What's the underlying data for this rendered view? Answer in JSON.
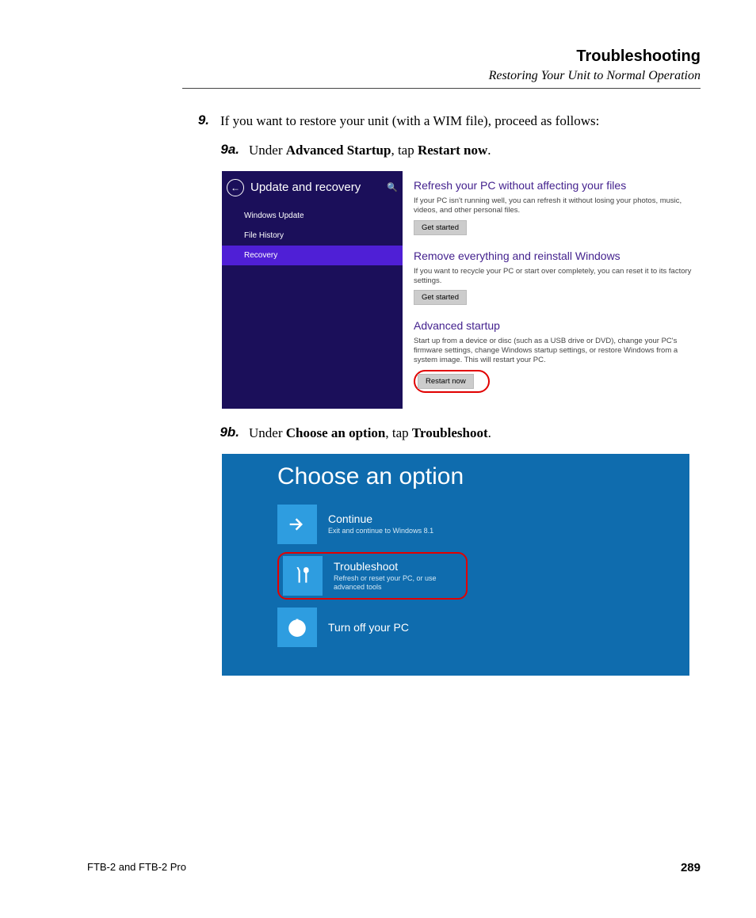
{
  "header": {
    "title": "Troubleshooting",
    "subtitle": "Restoring Your Unit to Normal Operation"
  },
  "step9": {
    "num": "9.",
    "text_plain": "If you want to restore your unit (with a WIM file), proceed as follows:"
  },
  "step9a": {
    "num": "9a.",
    "prefix": "Under ",
    "bold1": "Advanced Startup",
    "mid": ", tap ",
    "bold2": "Restart now",
    "suffix": "."
  },
  "step9b": {
    "num": "9b.",
    "prefix": "Under ",
    "bold1": "Choose an option",
    "mid": ", tap ",
    "bold2": "Troubleshoot",
    "suffix": "."
  },
  "shot1": {
    "panel_title": "Update and recovery",
    "nav": {
      "item1": "Windows Update",
      "item2": "File History",
      "item3": "Recovery"
    },
    "refresh": {
      "heading": "Refresh your PC without affecting your files",
      "desc": "If your PC isn't running well, you can refresh it without losing your photos, music, videos, and other personal files.",
      "button": "Get started"
    },
    "remove": {
      "heading": "Remove everything and reinstall Windows",
      "desc": "If you want to recycle your PC or start over completely, you can reset it to its factory settings.",
      "button": "Get started"
    },
    "advanced": {
      "heading": "Advanced startup",
      "desc": "Start up from a device or disc (such as a USB drive or DVD), change your PC's firmware settings, change Windows startup settings, or restore Windows from a system image. This will restart your PC.",
      "button": "Restart now"
    }
  },
  "shot2": {
    "title": "Choose an option",
    "options": {
      "continue": {
        "title": "Continue",
        "desc": "Exit and continue to Windows 8.1"
      },
      "troubleshoot": {
        "title": "Troubleshoot",
        "desc": "Refresh or reset your PC, or use advanced tools"
      },
      "turnoff": {
        "title": "Turn off your PC",
        "desc": ""
      }
    }
  },
  "footer": {
    "left": "FTB-2 and FTB-2 Pro",
    "page": "289"
  }
}
